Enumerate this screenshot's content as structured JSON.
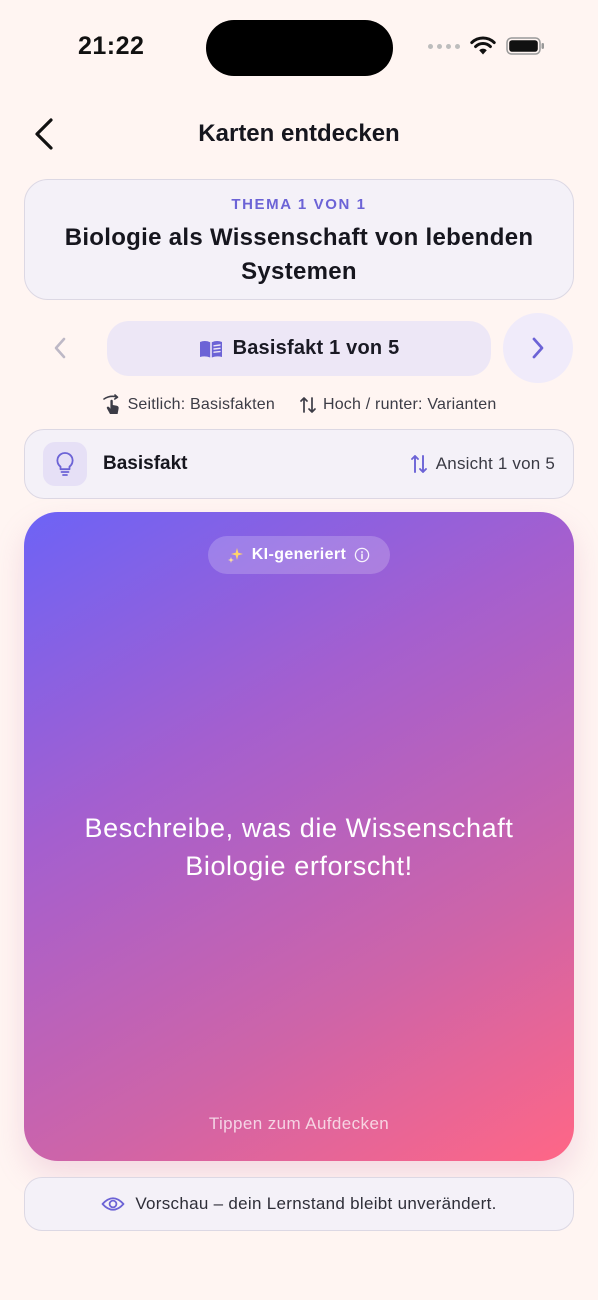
{
  "status_bar": {
    "time": "21:22",
    "icons": [
      "cellular-signal-icon",
      "wifi-icon",
      "battery-icon"
    ]
  },
  "nav": {
    "back_icon": "chevron-left-icon",
    "title": "Karten entdecken"
  },
  "topic": {
    "eyebrow": "THEMA 1 VON 1",
    "title": "Biologie als Wissenschaft von lebenden Systemen"
  },
  "pager": {
    "prev_icon": "chevron-left-icon",
    "label": "Basisfakt 1 von 5",
    "label_icon": "book-open-icon",
    "next_icon": "chevron-right-icon"
  },
  "hints": {
    "sideways": "Seitlich: Basisfakten",
    "sideways_icon": "swipe-hand-icon",
    "updown": "Hoch / runter: Varianten",
    "updown_icon": "arrows-up-down-icon"
  },
  "card_type": {
    "icon": "lightbulb-icon",
    "label": "Basisfakt",
    "view_icon": "arrows-up-down-icon",
    "view_label": "Ansicht 1 von 5"
  },
  "flash_card": {
    "badge_label": "KI-generiert",
    "badge_icon": "sparkles-icon",
    "badge_info_icon": "info-icon",
    "question": "Beschreibe, was die Wissenschaft Biologie erforscht!",
    "hint": "Tippen zum Aufdecken",
    "gradient_colors": [
      "#6D63F6",
      "#A45FCF",
      "#CE64A8",
      "#FF6686"
    ]
  },
  "preview_notice": {
    "icon": "eye-icon",
    "text": "Vorschau – dein Lernstand bleibt unverändert."
  },
  "colors": {
    "background": "#FFF5F2",
    "accent": "#6C63D6",
    "panel": "#F4F1F8"
  }
}
